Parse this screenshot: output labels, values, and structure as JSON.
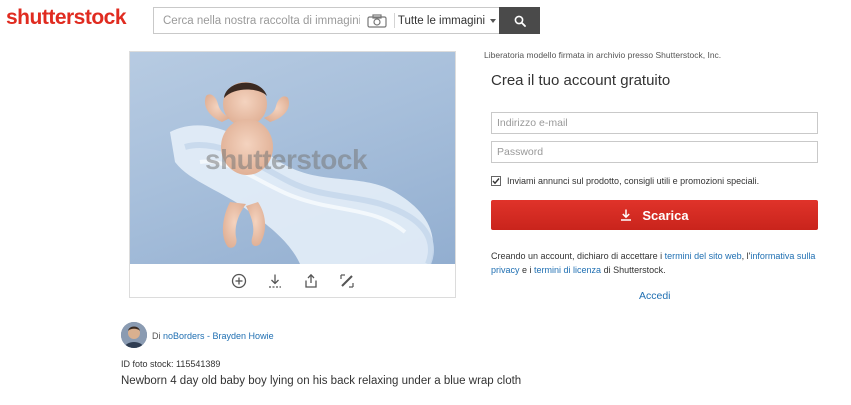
{
  "header": {
    "logo_text": "shutterstock",
    "search_placeholder": "Cerca nella nostra raccolta di immagini",
    "category_label": "Tutte le immagini",
    "icons": {
      "camera": "camera-icon",
      "search": "search-icon",
      "caret": "chevron-down-icon"
    }
  },
  "image_panel": {
    "watermark": "shutterstock",
    "tools": [
      "zoom-in-icon",
      "download-icon",
      "share-icon",
      "edit-icon"
    ]
  },
  "signup": {
    "release_note": "Liberatoria modello firmata in archivio presso Shutterstock, Inc.",
    "title": "Crea il tuo account gratuito",
    "email_placeholder": "Indirizzo e-mail",
    "password_placeholder": "Password",
    "opt_in_checked": true,
    "opt_in_label": "Inviami annunci sul prodotto, consigli utili e promozioni speciali.",
    "download_label": "Scarica",
    "terms": {
      "part1": "Creando un account, dichiaro di accettare i ",
      "link1": "termini del sito web",
      "part2": ", l'",
      "link2": "informativa sulla privacy",
      "part3": " e i ",
      "link3": "termini di licenza",
      "part4": " di Shutterstock."
    },
    "login_label": "Accedi"
  },
  "info": {
    "author_prefix": "Di",
    "author_name": "noBorders - Brayden Howie",
    "stock_id": "ID foto stock: 115541389",
    "description": "Newborn 4 day old baby boy lying on his back relaxing under a blue wrap cloth"
  },
  "colors": {
    "brand_red": "#e02b20",
    "button_red": "#d42c22",
    "link_blue": "#1f6fb2",
    "search_button": "#4a4a4a"
  }
}
